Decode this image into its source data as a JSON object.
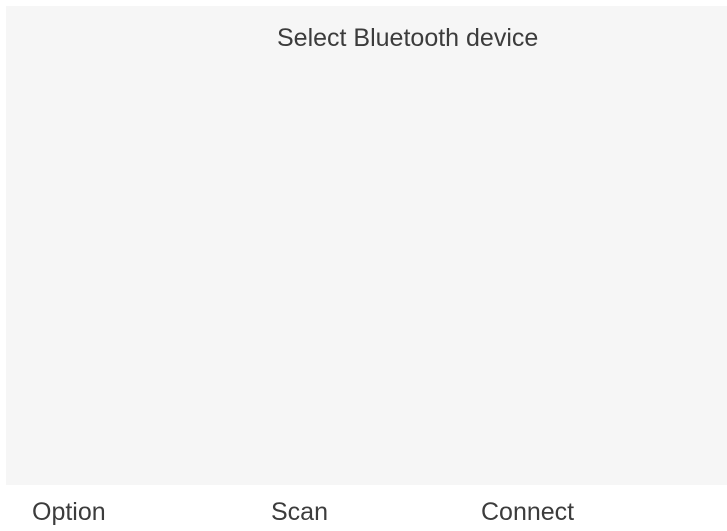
{
  "screen": {
    "title": "Select Bluetooth device"
  },
  "device_list": {
    "items": []
  },
  "softkeys": {
    "option": "Option",
    "scan": "Scan",
    "connect": "Connect"
  },
  "colors": {
    "panel_background": "#f6f6f6",
    "text": "#3c3c3c",
    "page_background": "#ffffff"
  }
}
